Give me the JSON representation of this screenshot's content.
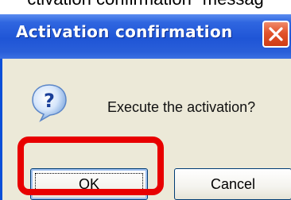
{
  "caption": {
    "text": "ctivation confirmation\" messag"
  },
  "dialog": {
    "title": "Activation confirmation",
    "message": "Execute the activation?",
    "buttons": {
      "ok_label": "OK",
      "cancel_label": "Cancel"
    },
    "icons": {
      "help": "question-help-icon",
      "close": "close-icon"
    }
  },
  "colors": {
    "titlebar": "#1f55d6",
    "close_button": "#e2532c",
    "dialog_background": "#ece9d8",
    "highlight_annotation": "#e80000"
  }
}
